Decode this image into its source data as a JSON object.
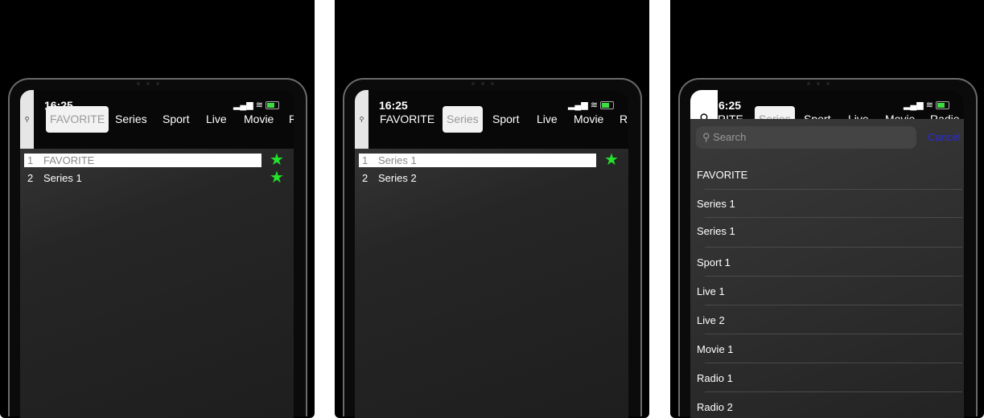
{
  "status": {
    "time": "16:25",
    "time_clipped": "6:25"
  },
  "colors": {
    "star": "#22e32a",
    "cancel": "#2a2ae0",
    "background": "#000000"
  },
  "tabs": [
    "FAVORITE",
    "Series",
    "Sport",
    "Live",
    "Movie",
    "R"
  ],
  "tabs_third": [
    "RITE",
    "Series",
    "Sport",
    "Live",
    "Movie",
    "Radio"
  ],
  "search_icon": "magnifier-icon",
  "screen1": {
    "selected_tab": "FAVORITE",
    "rows": [
      {
        "n": "1",
        "label": "FAVORITE",
        "star": true
      },
      {
        "n": "2",
        "label": "Series 1",
        "star": true
      }
    ]
  },
  "screen2": {
    "selected_tab": "Series",
    "rows": [
      {
        "n": "1",
        "label": "Series 1",
        "star": true
      },
      {
        "n": "2",
        "label": "Series 2",
        "star": false
      }
    ]
  },
  "screen3": {
    "search_placeholder": "Search",
    "cancel_label": "Cancel",
    "items": [
      "FAVORITE",
      "Series 1",
      "Series 1",
      "Sport 1",
      "Live 1",
      "Live 2",
      "Movie 1",
      "Radio 1",
      "Radio 2"
    ]
  },
  "star_glyph": "★"
}
